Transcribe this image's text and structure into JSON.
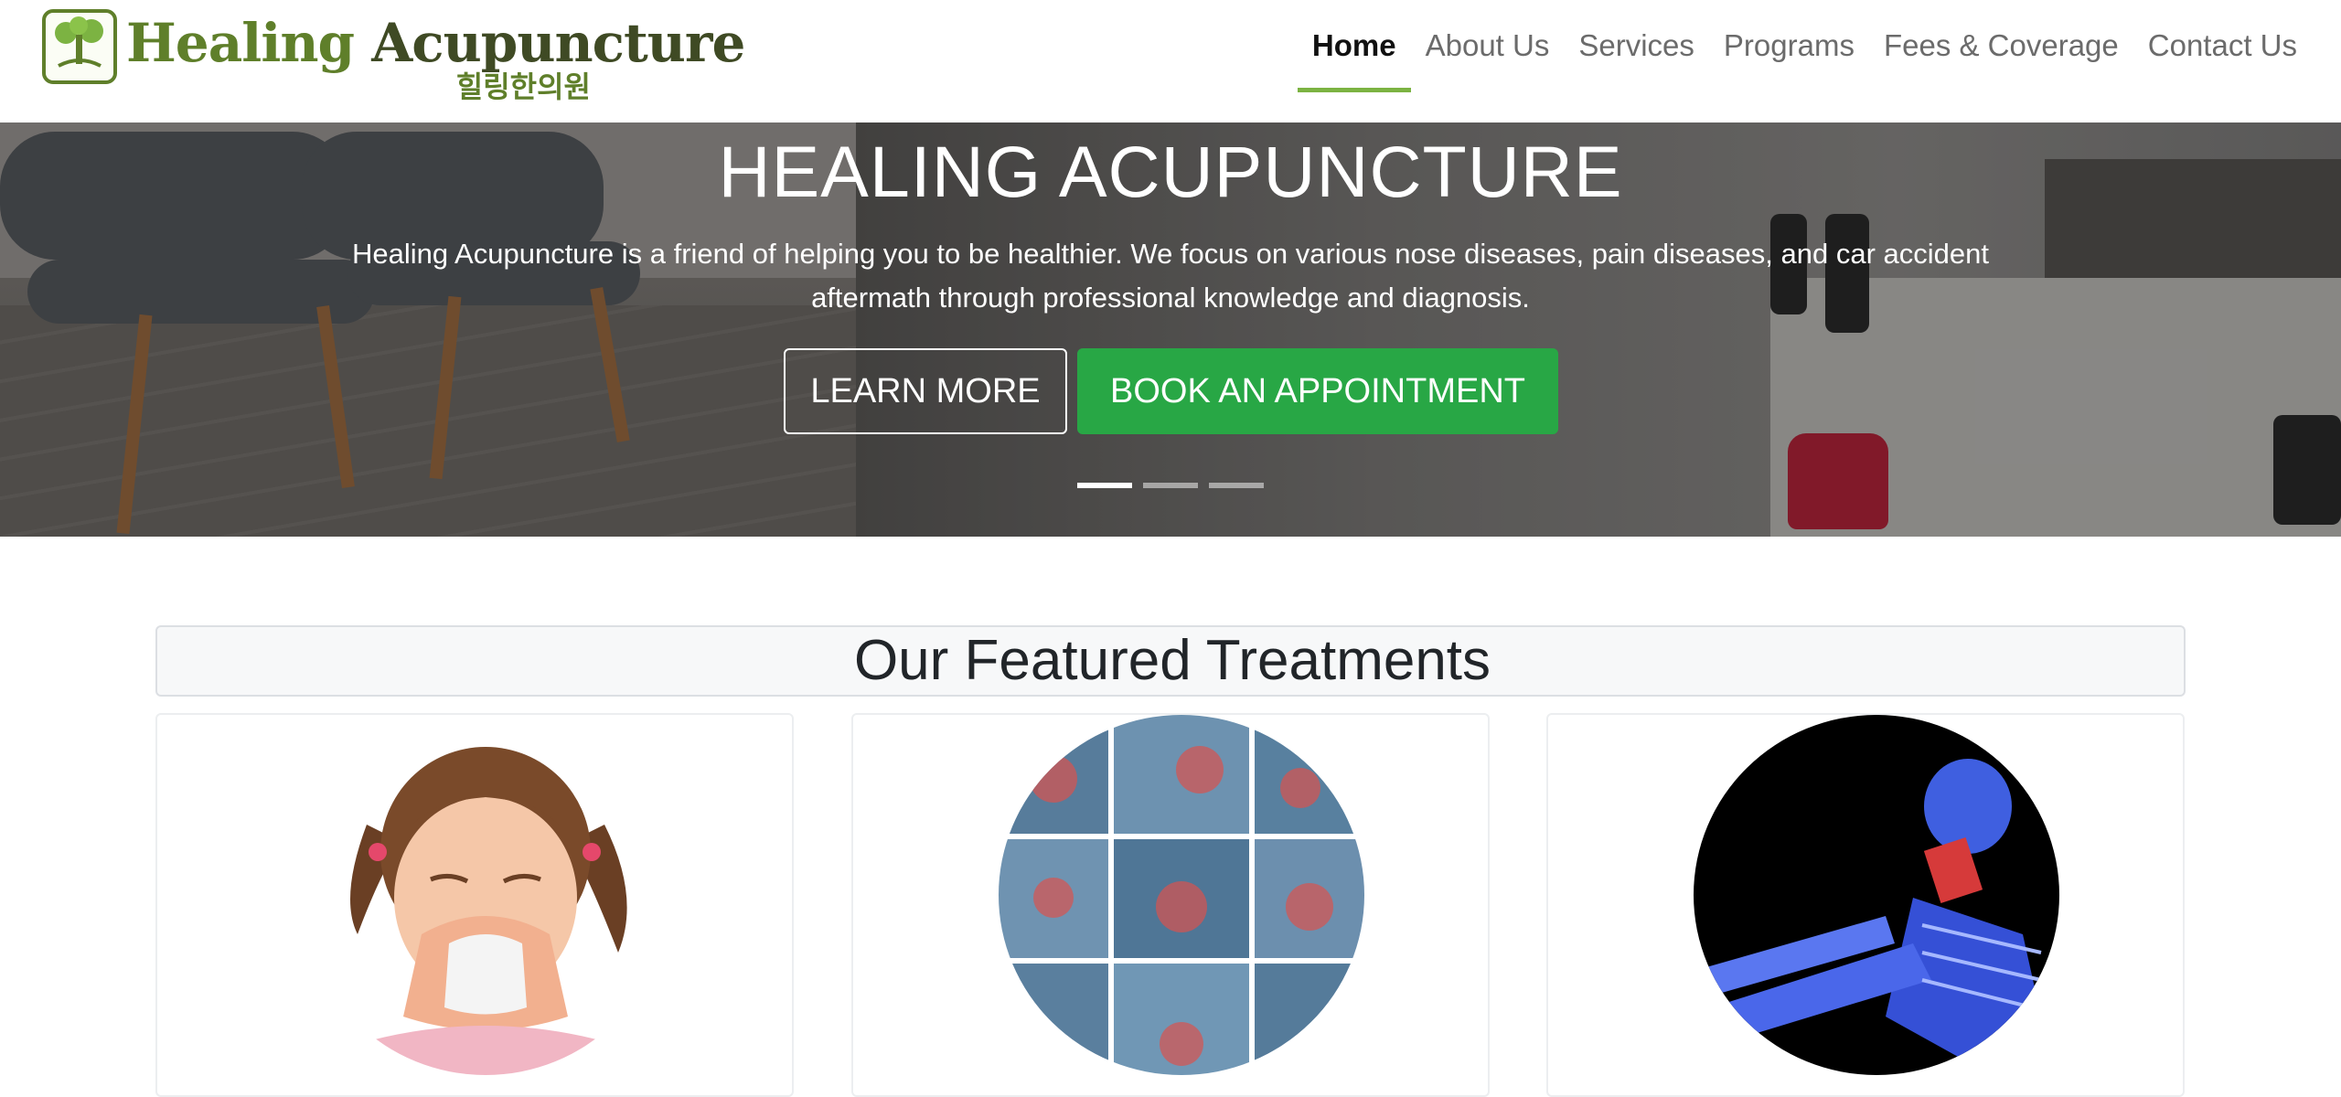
{
  "brand": {
    "logo_text_1": "Healing",
    "logo_text_2": "Acupuncture",
    "logo_korean": "힐링한의원",
    "logo_color": "#5f7f2a"
  },
  "nav": {
    "items": [
      {
        "label": "Home",
        "active": true
      },
      {
        "label": "About Us"
      },
      {
        "label": "Services"
      },
      {
        "label": "Programs"
      },
      {
        "label": "Fees & Coverage"
      },
      {
        "label": "Contact Us"
      }
    ],
    "active_underline_color": "#7cb342"
  },
  "hero": {
    "title": "HEALING ACUPUNCTURE",
    "subtitle": "Healing Acupuncture is a friend of helping you to be healthier. We focus on various nose diseases, pain diseases, and car accident aftermath through professional knowledge and diagnosis.",
    "learn_more_label": "LEARN MORE",
    "book_label": "BOOK AN APPOINTMENT",
    "book_color": "#28a745",
    "slides_total": 3,
    "slide_active": 1
  },
  "featured": {
    "heading": "Our Featured Treatments",
    "cards": [
      {
        "image": "sneezing-child-image"
      },
      {
        "image": "joint-pain-collage-image"
      },
      {
        "image": "neck-pain-skeleton-image"
      }
    ]
  }
}
